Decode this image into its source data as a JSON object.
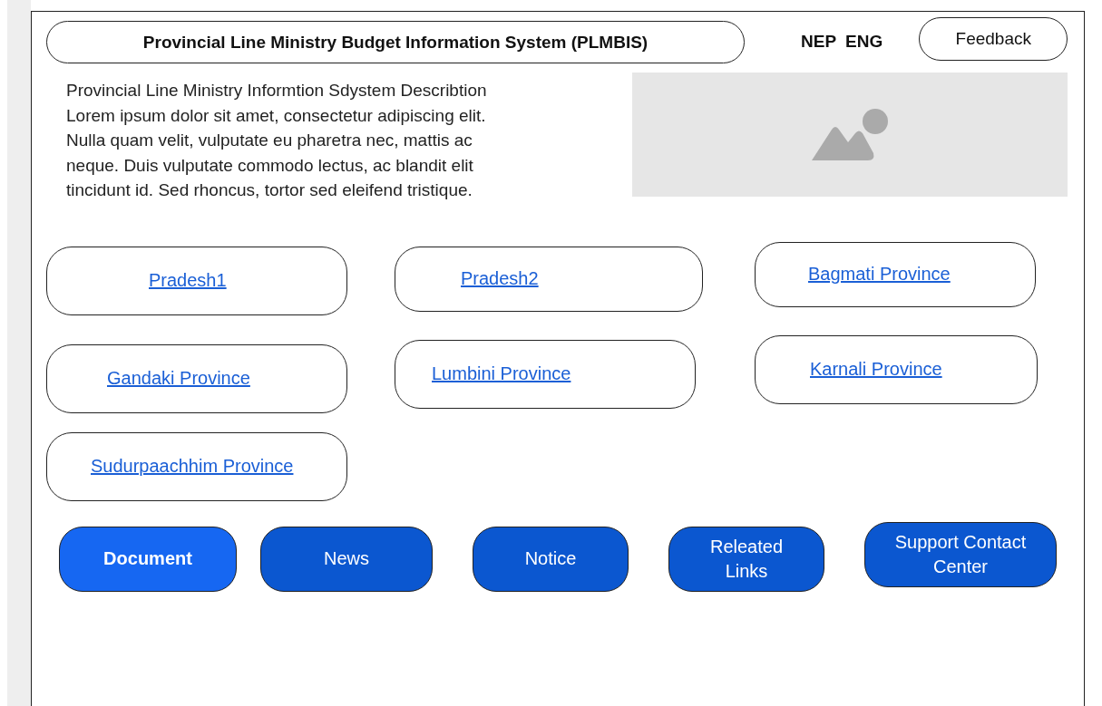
{
  "header": {
    "title": "Provincial Line Ministry Budget Information System (PLMBIS)",
    "languages": [
      {
        "label": "NEP"
      },
      {
        "label": "ENG"
      }
    ],
    "feedback": "Feedback"
  },
  "description": {
    "lines": [
      "Provincial Line Ministry Informtion Sdystem Describtion",
      "Lorem ipsum dolor sit amet, consectetur adipiscing elit.",
      "Nulla quam velit, vulputate eu pharetra nec, mattis ac",
      "neque. Duis vulputate commodo lectus, ac blandit elit",
      "tincidunt id. Sed rhoncus, tortor sed eleifend tristique."
    ]
  },
  "provinces": [
    {
      "label": "Pradesh1"
    },
    {
      "label": "Pradesh2"
    },
    {
      "label": "Bagmati Province"
    },
    {
      "label": "Gandaki Province"
    },
    {
      "label": "Lumbini Province"
    },
    {
      "label": "Karnali Province"
    },
    {
      "label": "Sudurpaachhim Province"
    }
  ],
  "nav": [
    {
      "label": "Document",
      "selected": true
    },
    {
      "label": "News",
      "selected": false
    },
    {
      "label": "Notice",
      "selected": false
    },
    {
      "label": "Releated Links",
      "selected": false
    },
    {
      "label": "Support Contact Center",
      "selected": false
    }
  ]
}
